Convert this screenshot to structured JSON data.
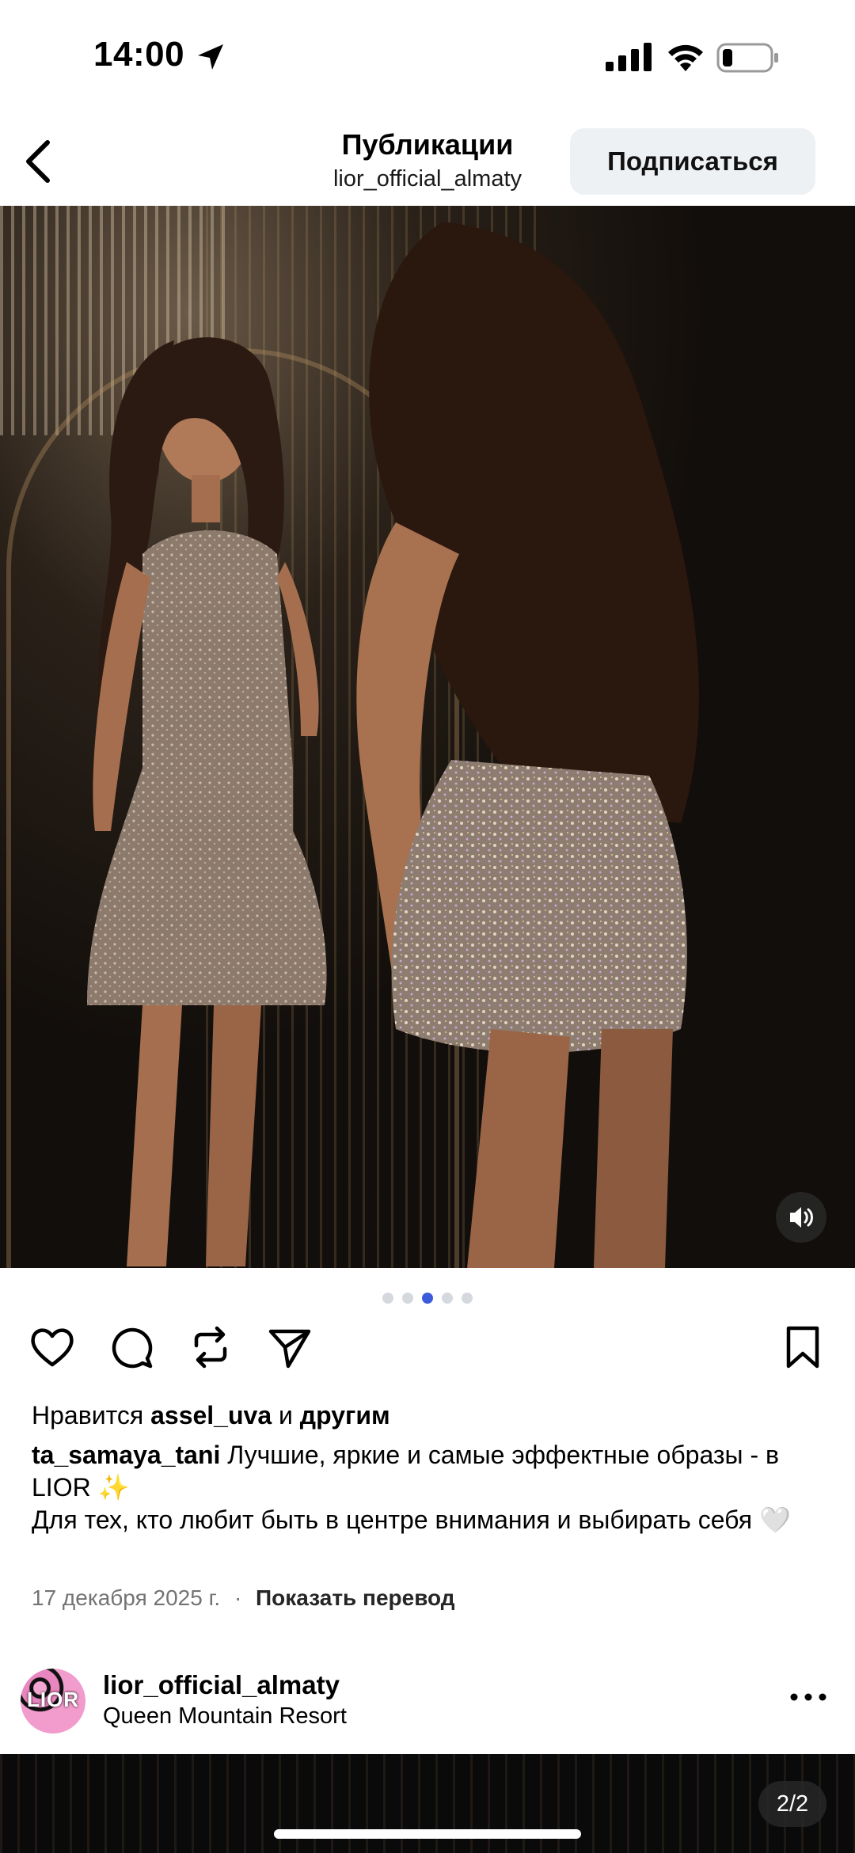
{
  "status_bar": {
    "time": "14:00"
  },
  "header": {
    "title": "Публикации",
    "subtitle": "lior_official_almaty",
    "follow_label": "Подписаться"
  },
  "post": {
    "carousel": {
      "total": 5,
      "active": 3
    },
    "likes": {
      "prefix": "Нравится",
      "user": "assel_uva",
      "conj": "и",
      "others": "другим"
    },
    "caption": {
      "user": "ta_samaya_tani",
      "text_line1": "Лучшие, яркие и самые эффектные образы - в LIOR ✨",
      "text_line2": "Для тех, кто любит быть в центре внимания и выбирать себя 🤍"
    },
    "date": "17 декабря 2025 г.",
    "separator": "·",
    "translate_label": "Показать перевод"
  },
  "next_post": {
    "avatar_text": "LIOR",
    "username": "lior_official_almaty",
    "location": "Queen Mountain Resort",
    "counter": "2/2"
  },
  "icons": [
    "location-arrow-icon",
    "signal-icon",
    "wifi-icon",
    "battery-icon",
    "back-icon",
    "sound-on-icon",
    "heart-icon",
    "comment-icon",
    "repost-icon",
    "share-icon",
    "bookmark-icon",
    "more-icon"
  ],
  "colors": {
    "follow_bg": "#eef1f4",
    "active_dot": "#3b5bdb",
    "inactive_dot": "#d5d9de",
    "meta_gray": "#737373"
  }
}
